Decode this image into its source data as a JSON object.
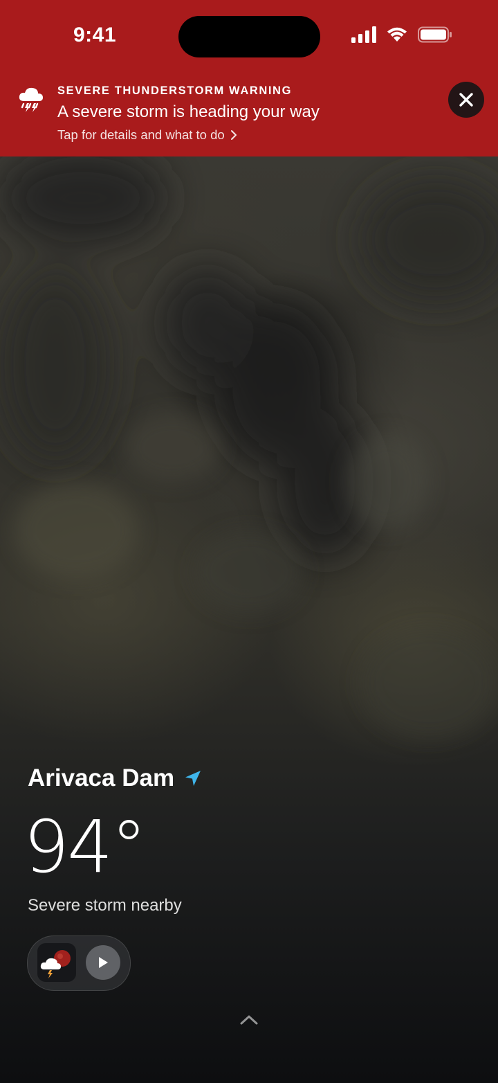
{
  "status_bar": {
    "time": "9:41",
    "icons": [
      "cellular-signal-icon",
      "wifi-icon",
      "battery-icon"
    ]
  },
  "alert": {
    "icon": "thunderstorm-icon",
    "kicker": "SEVERE THUNDERSTORM WARNING",
    "title": "A severe storm is heading your way",
    "subtitle": "Tap for details and what to do",
    "close_icon": "close-icon",
    "background_color": "#a91b1c"
  },
  "weather": {
    "location": "Arivaca Dam",
    "location_icon": "location-arrow-icon",
    "location_icon_color": "#3fb5ea",
    "temperature": "94°",
    "condition": "Severe storm nearby"
  },
  "media": {
    "app_icon": "weather-app-icon",
    "play_icon": "play-icon"
  },
  "bottom": {
    "icon": "chevron-up-icon"
  }
}
